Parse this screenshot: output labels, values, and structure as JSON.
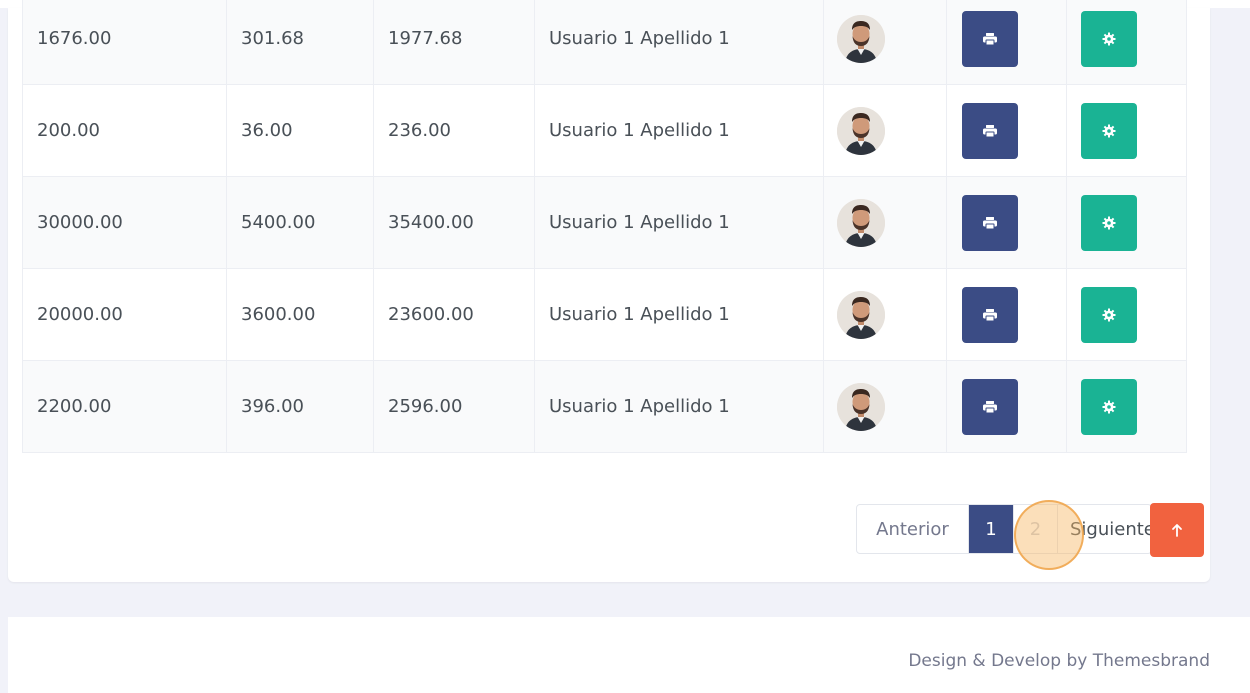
{
  "table": {
    "rows": [
      {
        "subtotal": "1676.00",
        "tax": "301.68",
        "total": "1977.68",
        "user": "Usuario 1 Apellido 1"
      },
      {
        "subtotal": "200.00",
        "tax": "36.00",
        "total": "236.00",
        "user": "Usuario 1 Apellido 1"
      },
      {
        "subtotal": "30000.00",
        "tax": "5400.00",
        "total": "35400.00",
        "user": "Usuario 1 Apellido 1"
      },
      {
        "subtotal": "20000.00",
        "tax": "3600.00",
        "total": "23600.00",
        "user": "Usuario 1 Apellido 1"
      },
      {
        "subtotal": "2200.00",
        "tax": "396.00",
        "total": "2596.00",
        "user": "Usuario 1 Apellido 1"
      }
    ],
    "row_icons": {
      "print": "print-icon",
      "settings": "gear-icon",
      "avatar": "avatar-photo"
    }
  },
  "pagination": {
    "prev_label": "Anterior",
    "pages": [
      "1",
      "2"
    ],
    "active_page": "1",
    "next_label": "Siguiente"
  },
  "back_to_top_icon": "arrow-up-icon",
  "footer": {
    "text": "Design & Develop by Themesbrand"
  },
  "colors": {
    "primary": "#3b4c85",
    "success": "#1ab394",
    "danger": "#f1623f",
    "page_bg": "#f1f2f9"
  }
}
